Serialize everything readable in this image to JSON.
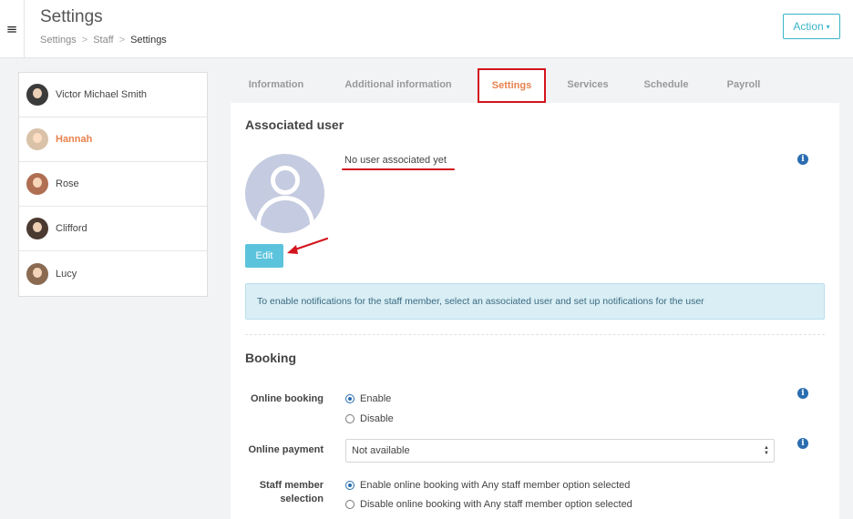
{
  "header": {
    "menu_icon": "hamburger-icon",
    "title": "Settings",
    "breadcrumb": [
      "Settings",
      "Staff",
      "Settings"
    ],
    "breadcrumb_sep": ">",
    "action_label": "Action",
    "action_caret": "▾",
    "accent": "#3ab5c8"
  },
  "staff": [
    {
      "name": "Victor Michael Smith",
      "avatar_color": "#3b3b3b",
      "active": false
    },
    {
      "name": "Hannah",
      "avatar_color": "#d9c2a8",
      "active": true
    },
    {
      "name": "Rose",
      "avatar_color": "#b06e52",
      "active": false
    },
    {
      "name": "Clifford",
      "avatar_color": "#4a3a32",
      "active": false
    },
    {
      "name": "Lucy",
      "avatar_color": "#8a6b52",
      "active": false
    }
  ],
  "tabs": [
    "Information",
    "Additional information",
    "Settings",
    "Services",
    "Schedule",
    "Payroll"
  ],
  "active_tab": "Settings",
  "associated_user": {
    "title": "Associated user",
    "status": "No user associated yet",
    "edit_label": "Edit",
    "alert": "To enable notifications for the staff member, select an associated user and set up notifications for the user"
  },
  "booking": {
    "title": "Booking",
    "online_booking_label": "Online booking",
    "online_booking_options": [
      "Enable",
      "Disable"
    ],
    "online_booking_selected": "Enable",
    "online_payment_label": "Online payment",
    "online_payment_value": "Not available",
    "staff_member_selection_label": "Staff member selection",
    "staff_member_selection_options": [
      "Enable online booking with Any staff member option selected",
      "Disable online booking with Any staff member option selected"
    ],
    "staff_member_selection_selected": "Enable online booking with Any staff member option selected"
  },
  "icons": {
    "info": "i"
  },
  "colors": {
    "active_tab_text": "#e8824e",
    "highlight_red": "#d3141c",
    "edit_button": "#5bc4dc",
    "info_icon": "#2a6db0"
  }
}
